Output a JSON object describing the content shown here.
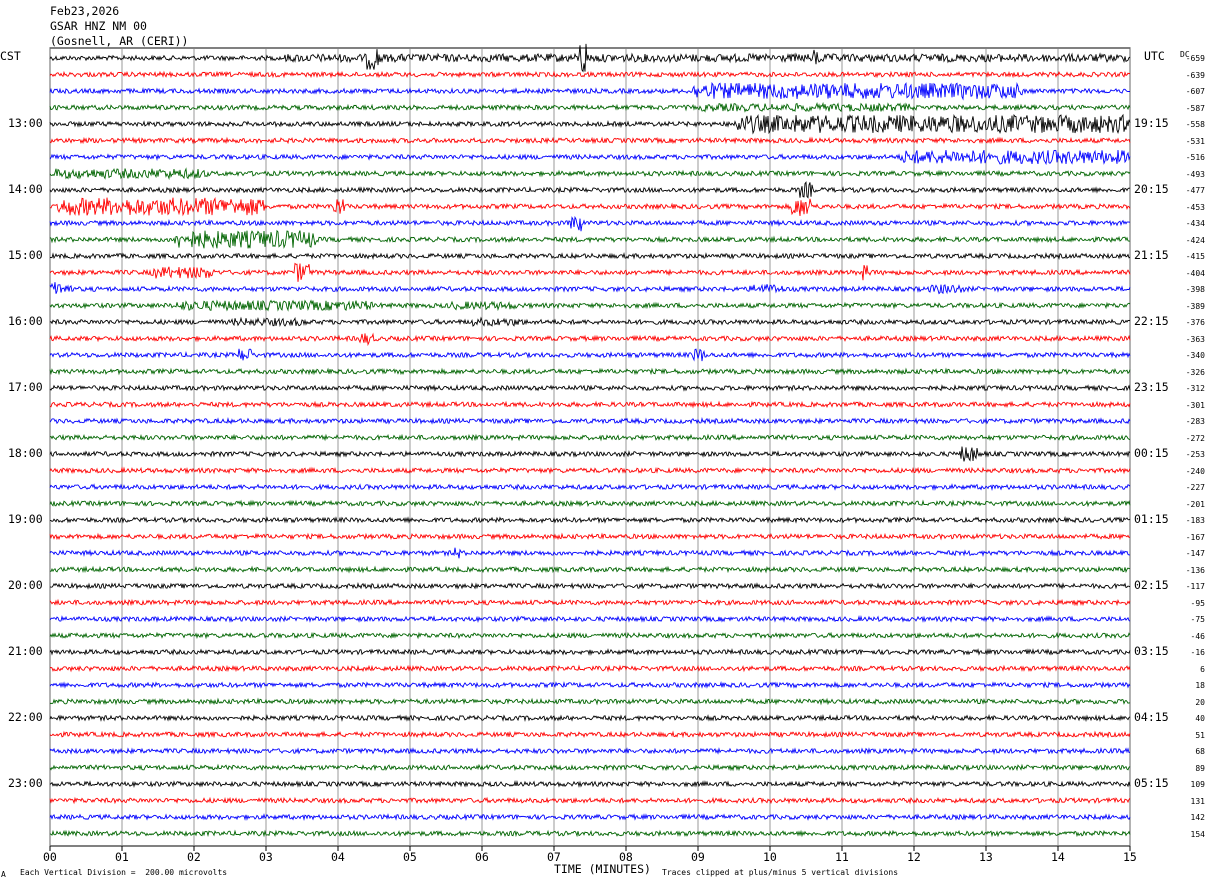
{
  "header": {
    "date": "Feb23,2026",
    "station": "GSAR HNZ NM 00",
    "location": "(Gosnell, AR (CERI))"
  },
  "left_tz": "CST",
  "right_tz": "UTC",
  "dc_header": "DC",
  "footer": {
    "scale": "Each Vertical Division =  200.00 microvolts",
    "clip_note": "Traces clipped at plus/minus 5 vertical divisions",
    "corner_mark": "A"
  },
  "colors": {
    "trace_cycle": [
      "#000000",
      "#ff0000",
      "#0000ff",
      "#006400"
    ],
    "grid": "#808080"
  },
  "chart_data": {
    "type": "helicorder",
    "xlabel": "TIME (MINUTES)",
    "x_ticks": [
      "00",
      "01",
      "02",
      "03",
      "04",
      "05",
      "06",
      "07",
      "08",
      "09",
      "10",
      "11",
      "12",
      "13",
      "14",
      "15"
    ],
    "xlim": [
      0,
      15
    ],
    "minutes_per_line": 15,
    "line_count": 48,
    "left_hour_labels": [
      "13:00",
      "14:00",
      "15:00",
      "16:00",
      "17:00",
      "18:00",
      "19:00",
      "20:00",
      "21:00",
      "22:00",
      "23:00"
    ],
    "right_hour_labels": [
      "19:15",
      "20:15",
      "21:15",
      "22:15",
      "23:15",
      "00:15",
      "01:15",
      "02:15",
      "03:15",
      "04:15",
      "05:15"
    ],
    "dc_offsets": [
      "-659",
      "-639",
      "-607",
      "-587",
      "-558",
      "-531",
      "-516",
      "-493",
      "-477",
      "-453",
      "-434",
      "-424",
      "-415",
      "-404",
      "-398",
      "-389",
      "-376",
      "-363",
      "-340",
      "-326",
      "-312",
      "-301",
      "-283",
      "-272",
      "-253",
      "-240",
      "-227",
      "-201",
      "-183",
      "-167",
      "-147",
      "-136",
      "-117",
      "-95",
      "-75",
      "-46",
      "-16",
      "6",
      "18",
      "20",
      "40",
      "51",
      "68",
      "89",
      "109",
      "131",
      "142",
      "154"
    ],
    "bursts": [
      {
        "line": 0,
        "start": 3.2,
        "end": 15.0,
        "amp": 4
      },
      {
        "line": 0,
        "start": 4.4,
        "end": 4.6,
        "amp": 12
      },
      {
        "line": 0,
        "start": 7.35,
        "end": 7.45,
        "amp": 20
      },
      {
        "line": 0,
        "start": 10.6,
        "end": 10.7,
        "amp": 9
      },
      {
        "line": 2,
        "start": 8.9,
        "end": 13.5,
        "amp": 8
      },
      {
        "line": 3,
        "start": 9.0,
        "end": 12.0,
        "amp": 4
      },
      {
        "line": 4,
        "start": 9.5,
        "end": 15.0,
        "amp": 9
      },
      {
        "line": 6,
        "start": 11.8,
        "end": 15.0,
        "amp": 7
      },
      {
        "line": 7,
        "start": 0.0,
        "end": 2.2,
        "amp": 5
      },
      {
        "line": 8,
        "start": 10.4,
        "end": 10.6,
        "amp": 8
      },
      {
        "line": 9,
        "start": 0.1,
        "end": 3.0,
        "amp": 9
      },
      {
        "line": 9,
        "start": 3.9,
        "end": 4.1,
        "amp": 9
      },
      {
        "line": 9,
        "start": 10.3,
        "end": 10.6,
        "amp": 10
      },
      {
        "line": 10,
        "start": 7.2,
        "end": 7.4,
        "amp": 9
      },
      {
        "line": 11,
        "start": 1.7,
        "end": 3.7,
        "amp": 9
      },
      {
        "line": 13,
        "start": 1.4,
        "end": 2.3,
        "amp": 6
      },
      {
        "line": 13,
        "start": 3.4,
        "end": 3.6,
        "amp": 10
      },
      {
        "line": 13,
        "start": 11.2,
        "end": 11.4,
        "amp": 8
      },
      {
        "line": 14,
        "start": 0.0,
        "end": 0.3,
        "amp": 7
      },
      {
        "line": 14,
        "start": 9.7,
        "end": 10.2,
        "amp": 5
      },
      {
        "line": 14,
        "start": 12.2,
        "end": 12.7,
        "amp": 5
      },
      {
        "line": 15,
        "start": 1.7,
        "end": 4.5,
        "amp": 5
      },
      {
        "line": 15,
        "start": 5.5,
        "end": 6.5,
        "amp": 4
      },
      {
        "line": 16,
        "start": 2.5,
        "end": 3.6,
        "amp": 4
      },
      {
        "line": 16,
        "start": 5.8,
        "end": 6.6,
        "amp": 4
      },
      {
        "line": 17,
        "start": 4.3,
        "end": 4.5,
        "amp": 6
      },
      {
        "line": 18,
        "start": 2.6,
        "end": 2.8,
        "amp": 7
      },
      {
        "line": 18,
        "start": 8.9,
        "end": 9.1,
        "amp": 7
      },
      {
        "line": 24,
        "start": 12.6,
        "end": 12.9,
        "amp": 8
      },
      {
        "line": 30,
        "start": 5.6,
        "end": 5.7,
        "amp": 6
      }
    ]
  }
}
